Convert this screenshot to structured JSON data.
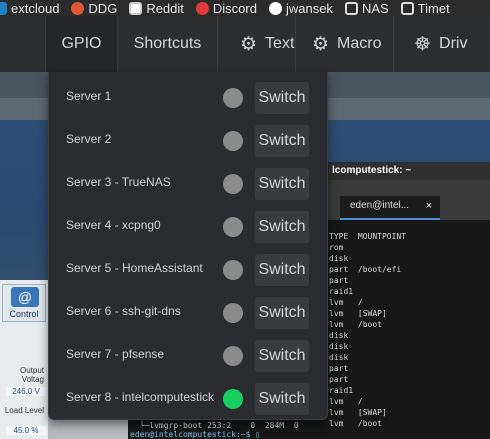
{
  "bookmarks": [
    {
      "label": "extcloud",
      "icon": "nextcloud-icon",
      "color": "#1c82c4"
    },
    {
      "label": "DDG",
      "icon": "duckduckgo-icon",
      "color": "#de5833"
    },
    {
      "label": "Reddit",
      "icon": "reddit-icon",
      "color": "#ff4500"
    },
    {
      "label": "Discord",
      "icon": "discord-icon",
      "color": "#5865f2"
    },
    {
      "label": "jwansek",
      "icon": "github-icon",
      "color": "#ffffff"
    },
    {
      "label": "NAS",
      "icon": "folder-icon",
      "color": "#dddddd"
    },
    {
      "label": "Timet",
      "icon": "calendar-icon",
      "color": "#ffffff"
    }
  ],
  "nav": {
    "tabs": [
      {
        "label": "GPIO",
        "icon": "",
        "active": true
      },
      {
        "label": "Shortcuts",
        "icon": ""
      },
      {
        "label": "Text",
        "icon": "gear-icon"
      },
      {
        "label": "Macro",
        "icon": "gear-icon"
      },
      {
        "label": "Driv",
        "icon": "steering-wheel-icon"
      }
    ]
  },
  "gpio": {
    "switch_label": "Switch",
    "servers": [
      {
        "name": "Server 1",
        "on": false
      },
      {
        "name": "Server 2",
        "on": false
      },
      {
        "name": "Server 3 - TrueNAS",
        "on": false
      },
      {
        "name": "Server 4 - xcpng0",
        "on": false
      },
      {
        "name": "Server 5 - HomeAssistant",
        "on": false
      },
      {
        "name": "Server 6 - ssh-git-dns",
        "on": false
      },
      {
        "name": "Server 7 - pfsense",
        "on": false
      },
      {
        "name": "Server 8 - intelcomputestick",
        "on": true
      }
    ],
    "colors": {
      "led_off": "#8b8b8b",
      "led_on": "#18cf5f"
    }
  },
  "background": {
    "control_label": "Control",
    "output_voltage_label": "Output Voltag",
    "output_voltage_value": "246.0 V",
    "load_level_label": "Load Level",
    "load_level_value": "45.0 %",
    "terminal_title": "lcomputestick: ~",
    "terminal_tab": "eden@intel...",
    "terminal_close": "×",
    "terminal_header": "TYPE  MOUNTPOINT",
    "terminal_lines": [
      "rom",
      "disk",
      "part  /boot/efi",
      "part",
      "raid1",
      "lvm   /",
      "lvm   [SWAP]",
      "lvm   /boot",
      "disk",
      "disk",
      "disk",
      "part",
      "part",
      "raid1",
      "lvm   /",
      "lvm   [SWAP]",
      "lvm   /boot"
    ],
    "terminal_partial_line": "  └─lvmgrp-boot 253:2    0  284M  0",
    "terminal_prompt": "eden@intelcomputestick:~$ ▯"
  }
}
